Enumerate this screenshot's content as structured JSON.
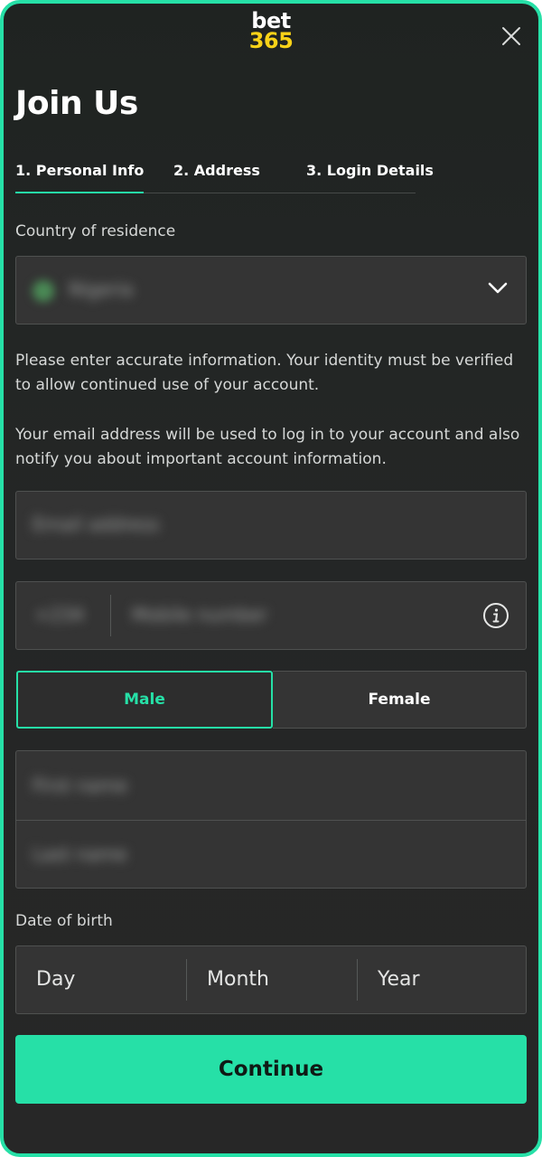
{
  "brand": {
    "logo_top": "bet",
    "logo_bottom": "365",
    "accent": "#26e0a7",
    "logo_yellow": "#f8d218"
  },
  "header": {
    "title": "Join Us",
    "close_icon": "close-icon"
  },
  "tabs": [
    {
      "label": "1.  Personal Info",
      "active": true
    },
    {
      "label": "2.  Address",
      "active": false
    },
    {
      "label": "3.  Login Details",
      "active": false
    }
  ],
  "country": {
    "label": "Country of residence",
    "value": "Nigeria"
  },
  "info_text": "Please enter accurate information. Your identity must be verified to allow continued use of your account.",
  "email_text": "Your email address will be used to log in to your account and also notify you about important account information.",
  "email": {
    "placeholder": "Email address"
  },
  "mobile": {
    "code": "+234",
    "placeholder": "Mobile number"
  },
  "gender": {
    "male": "Male",
    "female": "Female",
    "selected": "Male"
  },
  "name": {
    "first_placeholder": "First name",
    "last_placeholder": "Last name"
  },
  "dob": {
    "label": "Date of birth",
    "day": "Day",
    "month": "Month",
    "year": "Year"
  },
  "actions": {
    "continue": "Continue"
  }
}
